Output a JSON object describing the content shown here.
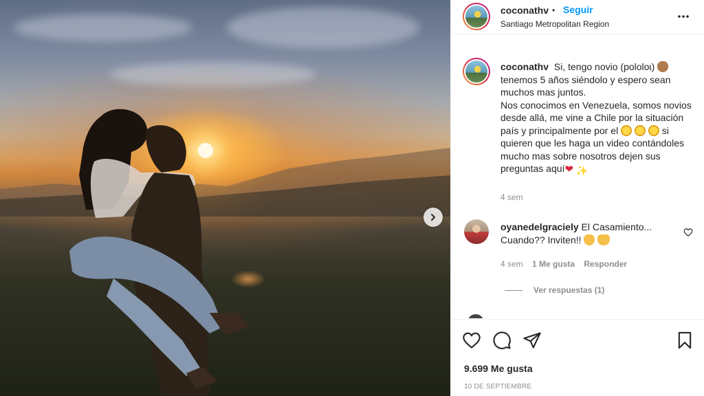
{
  "post": {
    "username": "coconathv",
    "follow_label": "Seguir",
    "separator": "•",
    "location": "Santiago Metropolitan Region",
    "caption": {
      "username": "coconathv",
      "line1": "Si, tengo novio (pololo",
      "line2": "tenemos 5 años siéndolo y espero sean muchos mas juntos.",
      "line3": "Nos conocimos en Venezuela, somos novios desde allá, me vine a Chile por la situación país y principalmente por el",
      "line4": "si quieren que les haga un video contándoles mucho mas sobre nosotros dejen sus preguntas aquí",
      "time": "4 sem"
    },
    "comment": {
      "username": "oyanedelgraciely",
      "text": "El Casamiento... Cuando?? Inviten!!",
      "time": "4 sem",
      "likes": "1 Me gusta",
      "reply_label": "Responder",
      "view_replies": "Ver respuestas (1)"
    },
    "likes_count": "9.699 Me gusta",
    "date": "10 DE SEPTIEMBRE"
  },
  "icons": {
    "more": "more-horizontal-icon",
    "next": "chevron-right-icon",
    "like": "heart-icon",
    "comment": "comment-icon",
    "share": "send-icon",
    "save": "bookmark-icon"
  },
  "colors": {
    "link": "#0095f6",
    "text": "#262626",
    "muted": "#8e8e8e",
    "border": "#efefef"
  }
}
